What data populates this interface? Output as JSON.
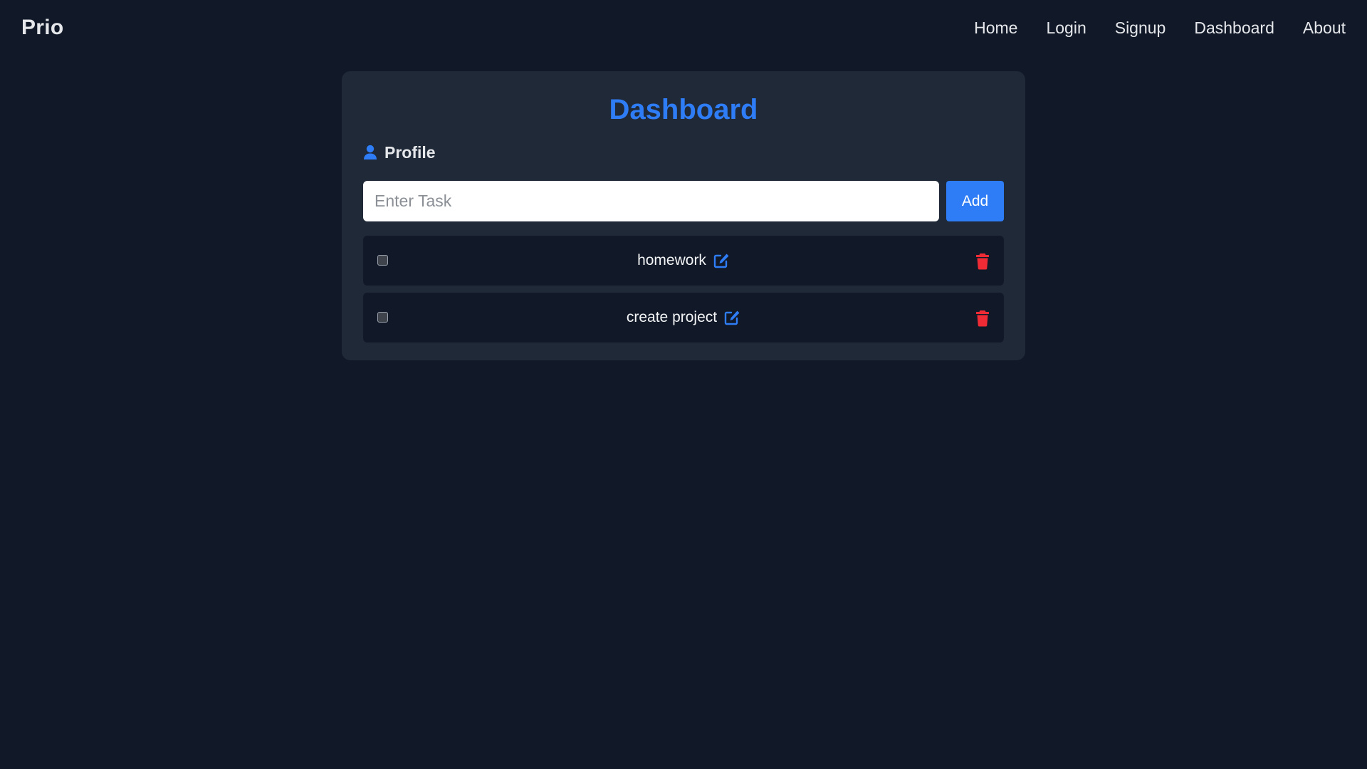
{
  "navbar": {
    "brand": "Prio",
    "links": [
      {
        "label": "Home"
      },
      {
        "label": "Login"
      },
      {
        "label": "Signup"
      },
      {
        "label": "Dashboard"
      },
      {
        "label": "About"
      }
    ]
  },
  "dashboard": {
    "title": "Dashboard",
    "profile": {
      "label": "Profile",
      "icon": "user-icon"
    },
    "task_input": {
      "placeholder": "Enter Task",
      "value": ""
    },
    "add_label": "Add",
    "tasks": [
      {
        "text": "homework",
        "checked": false
      },
      {
        "text": "create project",
        "checked": false
      }
    ]
  },
  "colors": {
    "background": "#111827",
    "card": "#1f2937",
    "accent": "#2f7df6",
    "danger": "#ef2b36",
    "text": "#e5e7eb"
  }
}
